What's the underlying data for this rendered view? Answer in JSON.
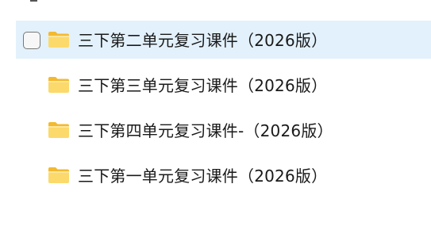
{
  "file_list": {
    "items": [
      {
        "name": "三下第二单元复习课件（2026版）",
        "icon": "folder-icon",
        "selected": true,
        "has_checkbox": true
      },
      {
        "name": "三下第三单元复习课件（2026版）",
        "icon": "folder-icon",
        "selected": false,
        "has_checkbox": false
      },
      {
        "name": "三下第四单元复习课件-（2026版）",
        "icon": "folder-icon",
        "selected": false,
        "has_checkbox": false
      },
      {
        "name": "三下第一单元复习课件（2026版）",
        "icon": "folder-icon",
        "selected": false,
        "has_checkbox": false
      }
    ]
  },
  "colors": {
    "selection_background": "#e3f1fc",
    "folder_body": "#fcd96b",
    "folder_tab": "#f3b92f",
    "text": "#1a1a1a"
  }
}
